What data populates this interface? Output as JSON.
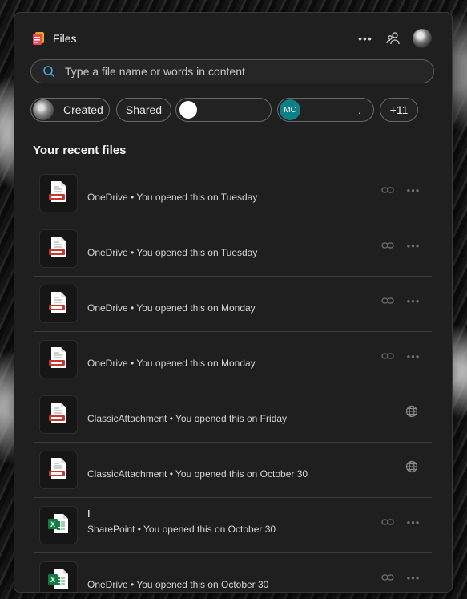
{
  "header": {
    "title": "Files"
  },
  "search": {
    "placeholder": "Type a file name or words in content"
  },
  "chips": [
    {
      "label": "Created"
    },
    {
      "label": "Shared"
    },
    {
      "label": ""
    },
    {
      "avatar_initials": "MC",
      "label": "."
    },
    {
      "label": "+11"
    }
  ],
  "section": {
    "title": "Your recent files"
  },
  "files": [
    {
      "name": "",
      "meta": "OneDrive • You opened this on Tuesday",
      "type": "pdf-icon",
      "actions": [
        "link-icon",
        "more-icon"
      ]
    },
    {
      "name": "",
      "meta": "OneDrive • You opened this on Tuesday",
      "type": "pdf-icon",
      "actions": [
        "link-icon",
        "more-icon"
      ]
    },
    {
      "name": "_",
      "meta": "OneDrive • You opened this on Monday",
      "type": "pdf-icon",
      "actions": [
        "link-icon",
        "more-icon"
      ]
    },
    {
      "name": "",
      "meta": "OneDrive • You opened this on Monday",
      "type": "pdf-icon",
      "actions": [
        "link-icon",
        "more-icon"
      ]
    },
    {
      "name": "",
      "meta": "ClassicAttachment • You opened this on Friday",
      "type": "pdf-icon",
      "actions": [
        "globe-icon"
      ]
    },
    {
      "name": "",
      "meta": "ClassicAttachment • You opened this on October 30",
      "type": "pdf-icon",
      "actions": [
        "globe-icon"
      ]
    },
    {
      "name": "I",
      "meta": "SharePoint • You opened this on October 30",
      "type": "excel-icon",
      "actions": [
        "link-icon",
        "more-icon"
      ]
    },
    {
      "name": "",
      "meta": "OneDrive • You opened this on October 30",
      "type": "excel-icon",
      "actions": [
        "link-icon",
        "more-icon"
      ]
    }
  ]
}
